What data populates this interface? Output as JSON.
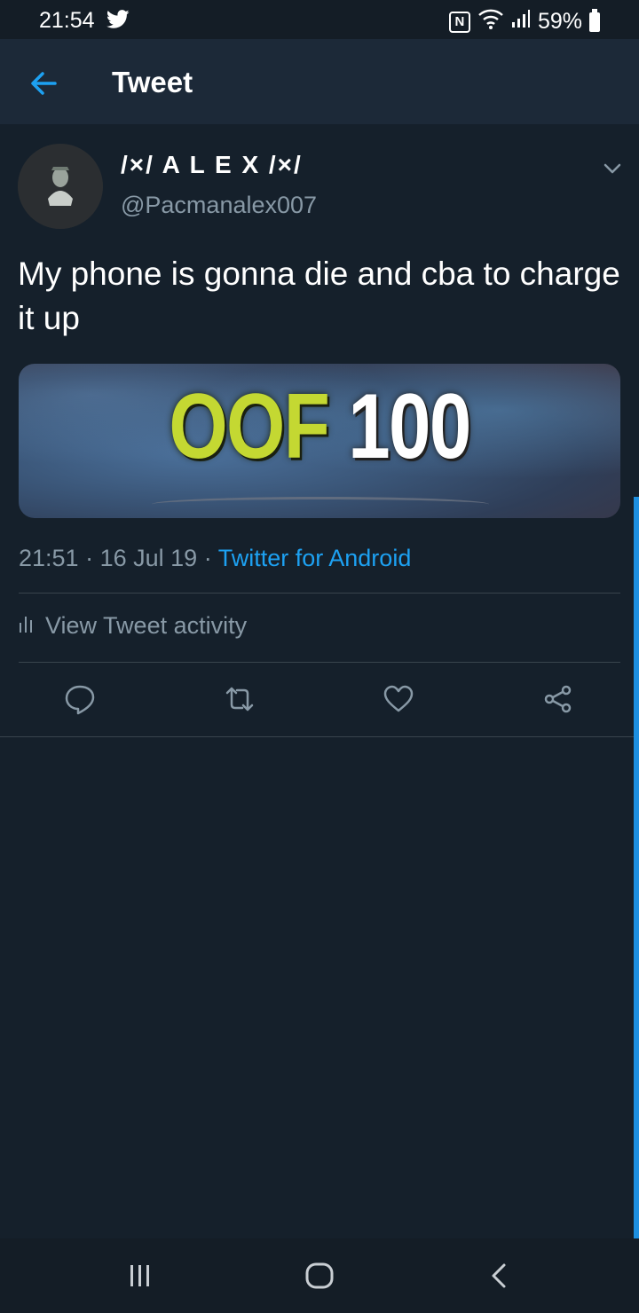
{
  "status_bar": {
    "time": "21:54",
    "notification_icon": "twitter-bird-icon",
    "nfc_label": "N",
    "battery": "59%"
  },
  "app_bar": {
    "title": "Tweet",
    "back_icon": "back-arrow-icon"
  },
  "tweet": {
    "display_name": "/×/ A L E X /×/",
    "handle": "@Pacmanalex007",
    "text": "My phone is gonna die and cba to charge it up",
    "media": {
      "word1": "OOF",
      "word2": "100"
    },
    "time": "21:51",
    "separator": "·",
    "date": "16 Jul 19",
    "source": "Twitter for Android"
  },
  "activity": {
    "label": "View Tweet activity"
  },
  "actions": {
    "icons": [
      "reply-icon",
      "retweet-icon",
      "like-icon",
      "share-icon"
    ]
  },
  "colors": {
    "background": "#15202b",
    "app_bar": "#1c2938",
    "accent": "#1da1f2",
    "secondary_text": "#8899a6",
    "divider": "#38444d"
  }
}
